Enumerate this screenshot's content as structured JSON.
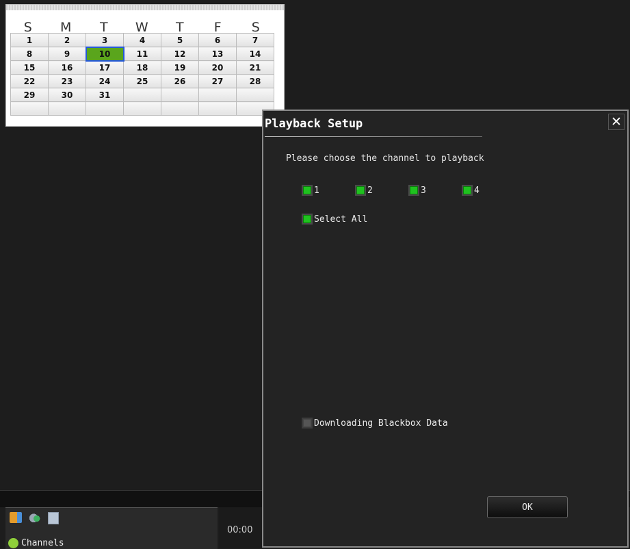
{
  "calendar": {
    "weekdays": [
      "S",
      "M",
      "T",
      "W",
      "T",
      "F",
      "S"
    ],
    "weeks": [
      [
        "1",
        "2",
        "3",
        "4",
        "5",
        "6",
        "7"
      ],
      [
        "8",
        "9",
        "10",
        "11",
        "12",
        "13",
        "14"
      ],
      [
        "15",
        "16",
        "17",
        "18",
        "19",
        "20",
        "21"
      ],
      [
        "22",
        "23",
        "24",
        "25",
        "26",
        "27",
        "28"
      ],
      [
        "29",
        "30",
        "31",
        "",
        "",
        "",
        ""
      ],
      [
        "",
        "",
        "",
        "",
        "",
        "",
        ""
      ]
    ],
    "selected_day": "10"
  },
  "bottom": {
    "channels_label": "Channels",
    "time": "00:00"
  },
  "dialog": {
    "title": "Playback Setup",
    "close_label": "✕",
    "prompt": "Please choose the channel to playback",
    "channels": [
      {
        "label": "1",
        "checked": true
      },
      {
        "label": "2",
        "checked": true
      },
      {
        "label": "3",
        "checked": true
      },
      {
        "label": "4",
        "checked": true
      }
    ],
    "select_all": {
      "label": "Select All",
      "checked": true
    },
    "blackbox": {
      "label": "Downloading Blackbox Data",
      "checked": false
    },
    "ok_label": "OK"
  },
  "colors": {
    "checked_green": "#1fc21f",
    "today_green": "#5aa51c",
    "today_border": "#2458d8"
  }
}
